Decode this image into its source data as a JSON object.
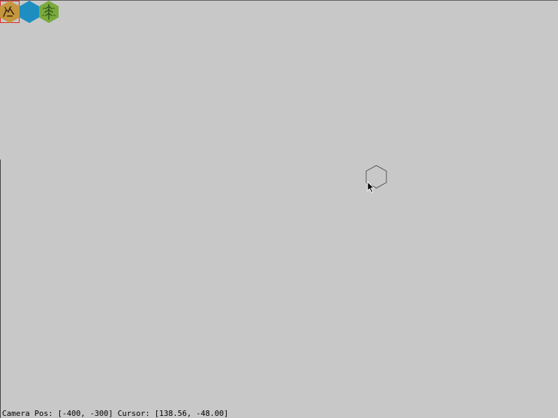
{
  "palette": {
    "tiles": [
      {
        "terrain": "desert",
        "icon": "desert-hex-icon",
        "color": "#c4963e",
        "selected": true
      },
      {
        "terrain": "water",
        "icon": "water-hex-icon",
        "color": "#1e8ec1",
        "selected": false
      },
      {
        "terrain": "forest",
        "icon": "forest-hex-icon",
        "color": "#7aaa3c",
        "selected": false
      }
    ]
  },
  "status": {
    "text": "Camera Pos: [-400, -300] Cursor: [138.56, -48.00]"
  },
  "colors": {
    "background": "#c8c8c8",
    "selection_outline": "#e0241c"
  }
}
